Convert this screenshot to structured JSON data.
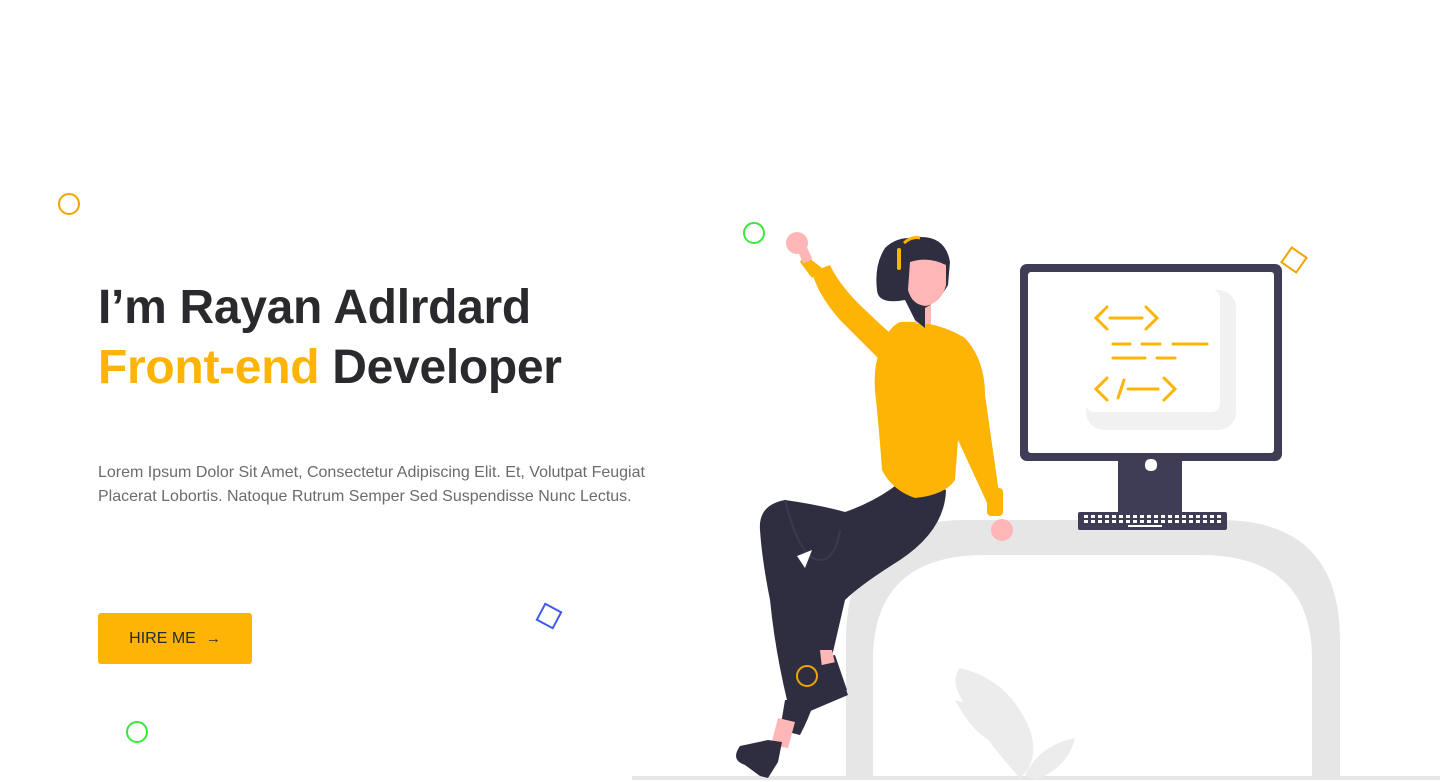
{
  "hero": {
    "greeting": "I’m Rayan Adlrdard",
    "role_highlight": "Front-end",
    "role_rest": " Developer",
    "description": "Lorem Ipsum Dolor Sit Amet, Consectetur Adipiscing Elit. Et, Volutpat Feugiat Placerat Lobortis. Natoque Rutrum Semper Sed Suspendisse Nunc Lectus."
  },
  "cta": {
    "label": "HIRE ME",
    "arrow": "→",
    "arrow_icon": "arrow-right-icon"
  },
  "monitor": {
    "code_open": "<—>",
    "code_close": "</—>"
  },
  "colors": {
    "accent": "#fdb404",
    "text_dark": "#2a2a2e",
    "text_muted": "#6b6b6b",
    "illustration_dark": "#3f3d56",
    "illustration_dark_alt": "#2f2e41",
    "illustration_gray": "#e6e6e6",
    "skin": "#ffb6b6",
    "deco_green": "#3ce63c",
    "deco_orange": "#f0a500",
    "deco_blue": "#3d5af1",
    "deco_red": "#f0542d"
  }
}
